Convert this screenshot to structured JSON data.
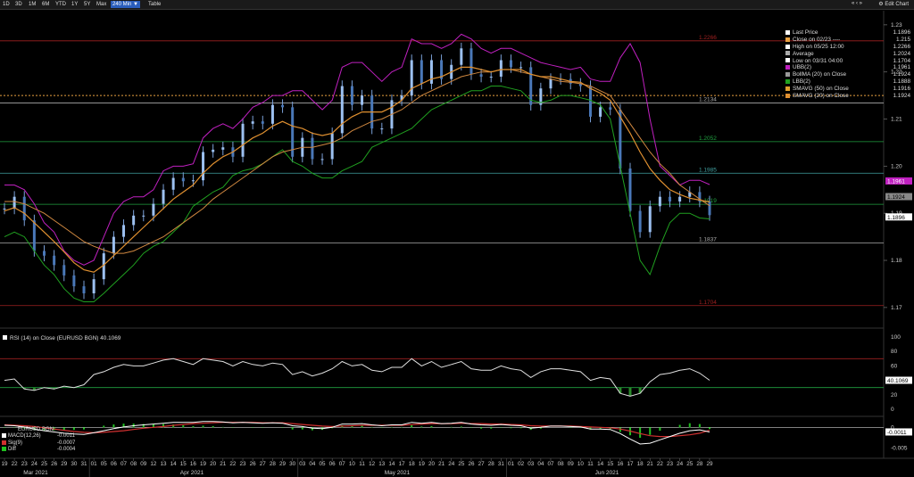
{
  "toolbar": {
    "ranges": [
      "1D",
      "3D",
      "1M",
      "6M",
      "YTD",
      "1Y",
      "5Y",
      "Max"
    ],
    "interval": "240 Min ▼",
    "table": "Table",
    "nav": "« ‹ »",
    "edit_chart": "Edit Chart",
    "edit_chart_icon": "gear-icon"
  },
  "legend": [
    {
      "label": "Last Price",
      "value": "1.1896",
      "color": "#ffffff"
    },
    {
      "label": "Close on 02/23 ----",
      "value": "1.215",
      "color": "#e8a040"
    },
    {
      "label": "High on 05/25 12:00",
      "value": "1.2266",
      "color": "#ffffff",
      "symbol": "T"
    },
    {
      "label": "Average",
      "value": "1.2024",
      "color": "#aaaaaa",
      "symbol": "+"
    },
    {
      "label": "Low on 03/31 04:00",
      "value": "1.1704",
      "color": "#ffffff",
      "symbol": "⊥"
    },
    {
      "label": "UBB(2)",
      "value": "1.1961",
      "color": "#c020c0"
    },
    {
      "label": "BollMA (20)  on Close",
      "value": "1.1924",
      "color": "#999999"
    },
    {
      "label": "LBB(2)",
      "value": "1.1888",
      "color": "#20a020"
    },
    {
      "label": "SMAVG (50)  on Close",
      "value": "1.1916",
      "color": "#e0a030"
    },
    {
      "label": "SMAVG (20)  on Close",
      "value": "1.1924",
      "color": "#e09030"
    }
  ],
  "price_axis_labels": [
    "1.23",
    "1.22",
    "1.21",
    "1.20",
    "1.19",
    "1.18",
    "1.17"
  ],
  "hline_labels": [
    "1.2266",
    "1.2134",
    "1.2052",
    "1.1985",
    "1.1919",
    "1.1837",
    "1.1704"
  ],
  "price_tags": [
    {
      "text": "1.1961",
      "color": "#c020c0",
      "textcolor": "#fff"
    },
    {
      "text": "1.1924",
      "color": "#888888",
      "textcolor": "#000"
    },
    {
      "text": "1.1896",
      "color": "#ffffff",
      "textcolor": "#000"
    }
  ],
  "rsi": {
    "title": "RSI (14)  on Close (EURUSD BGN) 40.1069",
    "axis_labels": [
      "100",
      "80",
      "60",
      "40",
      "20",
      "0"
    ],
    "tag": "40.1069"
  },
  "macd": {
    "title": "EURUSD BGN",
    "legend": [
      {
        "label": "MACD(12,26)",
        "value": "-0.0011",
        "color": "#ffffff"
      },
      {
        "label": "Sig(9)",
        "value": "-0.0007",
        "color": "#d03030"
      },
      {
        "label": "Diff",
        "value": "-0.0004",
        "color": "#20c020"
      }
    ],
    "axis_labels": [
      "0",
      "-0.005"
    ],
    "tag": "-0.0011"
  },
  "x_days": [
    "19",
    "22",
    "23",
    "24",
    "25",
    "26",
    "29",
    "30",
    "31",
    "01",
    "05",
    "06",
    "07",
    "08",
    "09",
    "12",
    "13",
    "14",
    "15",
    "16",
    "19",
    "20",
    "21",
    "22",
    "23",
    "26",
    "27",
    "28",
    "29",
    "30",
    "03",
    "04",
    "05",
    "06",
    "07",
    "10",
    "11",
    "12",
    "13",
    "14",
    "17",
    "18",
    "19",
    "20",
    "21",
    "24",
    "25",
    "26",
    "27",
    "28",
    "31",
    "01",
    "02",
    "03",
    "04",
    "07",
    "08",
    "09",
    "10",
    "11",
    "14",
    "15",
    "16",
    "17",
    "18",
    "21",
    "22",
    "23",
    "24",
    "25",
    "28",
    "29"
  ],
  "x_months": [
    "Mar 2021",
    "Apr 2021",
    "May 2021",
    "Jun 2021"
  ],
  "chart_data": {
    "type": "line",
    "title": "",
    "xlabel": "",
    "ylabel": "",
    "ylim": [
      1.166,
      1.233
    ],
    "x": [
      "Mar 19",
      "Mar 22",
      "Mar 23",
      "Mar 24",
      "Mar 25",
      "Mar 26",
      "Mar 29",
      "Mar 30",
      "Mar 31",
      "Apr 01",
      "Apr 05",
      "Apr 06",
      "Apr 07",
      "Apr 08",
      "Apr 09",
      "Apr 12",
      "Apr 13",
      "Apr 14",
      "Apr 15",
      "Apr 16",
      "Apr 19",
      "Apr 20",
      "Apr 21",
      "Apr 22",
      "Apr 23",
      "Apr 26",
      "Apr 27",
      "Apr 28",
      "Apr 29",
      "Apr 30",
      "May 03",
      "May 04",
      "May 05",
      "May 06",
      "May 07",
      "May 10",
      "May 11",
      "May 12",
      "May 13",
      "May 14",
      "May 17",
      "May 18",
      "May 19",
      "May 20",
      "May 21",
      "May 24",
      "May 25",
      "May 26",
      "May 27",
      "May 28",
      "May 31",
      "Jun 01",
      "Jun 02",
      "Jun 03",
      "Jun 04",
      "Jun 07",
      "Jun 08",
      "Jun 09",
      "Jun 10",
      "Jun 11",
      "Jun 14",
      "Jun 15",
      "Jun 16",
      "Jun 17",
      "Jun 18",
      "Jun 21",
      "Jun 22",
      "Jun 23",
      "Jun 24",
      "Jun 25",
      "Jun 28",
      "Jun 29"
    ],
    "series": [
      {
        "name": "Last Price",
        "color": "#8ab0e0",
        "values": [
          1.191,
          1.1935,
          1.1885,
          1.182,
          1.181,
          1.179,
          1.1768,
          1.1745,
          1.173,
          1.176,
          1.1815,
          1.185,
          1.1875,
          1.1895,
          1.1895,
          1.192,
          1.195,
          1.1975,
          1.1968,
          1.197,
          1.203,
          1.2035,
          1.204,
          1.202,
          1.209,
          1.2095,
          1.209,
          1.213,
          1.2125,
          1.202,
          1.206,
          1.2015,
          1.2015,
          1.207,
          1.217,
          1.213,
          1.215,
          1.208,
          1.208,
          1.214,
          1.215,
          1.2225,
          1.2175,
          1.2225,
          1.2185,
          1.2215,
          1.225,
          1.2195,
          1.219,
          1.219,
          1.2225,
          1.221,
          1.221,
          1.213,
          1.2165,
          1.2185,
          1.2185,
          1.2175,
          1.217,
          1.2105,
          1.2125,
          1.212,
          1.1995,
          1.1905,
          1.186,
          1.1915,
          1.1935,
          1.1925,
          1.1935,
          1.1945,
          1.1925,
          1.1896
        ]
      },
      {
        "name": "UBB(2)",
        "color": "#c020c0",
        "values": [
          1.196,
          1.196,
          1.195,
          1.192,
          1.188,
          1.186,
          1.182,
          1.18,
          1.179,
          1.18,
          1.185,
          1.19,
          1.1925,
          1.1935,
          1.1935,
          1.195,
          1.199,
          1.2,
          1.2,
          1.2005,
          1.206,
          1.208,
          1.209,
          1.208,
          1.21,
          1.2125,
          1.2135,
          1.215,
          1.215,
          1.216,
          1.216,
          1.214,
          1.212,
          1.214,
          1.221,
          1.222,
          1.222,
          1.22,
          1.218,
          1.22,
          1.221,
          1.227,
          1.226,
          1.226,
          1.225,
          1.226,
          1.228,
          1.227,
          1.225,
          1.224,
          1.225,
          1.225,
          1.224,
          1.223,
          1.222,
          1.2215,
          1.221,
          1.2205,
          1.221,
          1.2185,
          1.218,
          1.218,
          1.223,
          1.226,
          1.222,
          1.21,
          1.2,
          1.198,
          1.196,
          1.197,
          1.197,
          1.1961
        ]
      },
      {
        "name": "BollMA (20)  on Close",
        "color": "#999999",
        "values": [
          1.1905,
          1.1912,
          1.19,
          1.188,
          1.186,
          1.184,
          1.1818,
          1.1795,
          1.178,
          1.1775,
          1.179,
          1.181,
          1.183,
          1.185,
          1.187,
          1.189,
          1.191,
          1.193,
          1.1945,
          1.196,
          1.1985,
          1.2005,
          1.202,
          1.203,
          1.2045,
          1.206,
          1.207,
          1.2085,
          1.2095,
          1.2085,
          1.208,
          1.207,
          1.2065,
          1.207,
          1.209,
          1.2105,
          1.2115,
          1.2115,
          1.2115,
          1.2125,
          1.214,
          1.2165,
          1.2175,
          1.2185,
          1.219,
          1.22,
          1.221,
          1.221,
          1.2205,
          1.22,
          1.2205,
          1.2205,
          1.2205,
          1.2195,
          1.219,
          1.219,
          1.2185,
          1.218,
          1.2178,
          1.2165,
          1.2155,
          1.214,
          1.2105,
          1.207,
          1.203,
          1.1995,
          1.197,
          1.195,
          1.194,
          1.1932,
          1.1928,
          1.1924
        ]
      },
      {
        "name": "LBB(2)",
        "color": "#20a020",
        "values": [
          1.185,
          1.186,
          1.185,
          1.182,
          1.179,
          1.177,
          1.174,
          1.172,
          1.1712,
          1.1712,
          1.173,
          1.175,
          1.177,
          1.179,
          1.1815,
          1.183,
          1.184,
          1.186,
          1.188,
          1.1915,
          1.193,
          1.1945,
          1.1955,
          1.198,
          1.199,
          1.1995,
          1.2005,
          1.202,
          1.2035,
          1.201,
          1.2,
          1.1985,
          1.1975,
          1.1975,
          1.199,
          1.2,
          1.201,
          1.204,
          1.205,
          1.206,
          1.207,
          1.208,
          1.21,
          1.212,
          1.213,
          1.214,
          1.215,
          1.216,
          1.216,
          1.217,
          1.217,
          1.2165,
          1.216,
          1.214,
          1.2135,
          1.214,
          1.215,
          1.215,
          1.2145,
          1.214,
          1.213,
          1.21,
          1.2,
          1.19,
          1.18,
          1.177,
          1.183,
          1.188,
          1.19,
          1.19,
          1.189,
          1.1888
        ]
      },
      {
        "name": "SMAVG (50)  on Close",
        "color": "#d08840",
        "values": [
          1.1925,
          1.1925,
          1.192,
          1.191,
          1.19,
          1.1885,
          1.187,
          1.1855,
          1.184,
          1.183,
          1.1822,
          1.1815,
          1.1815,
          1.182,
          1.183,
          1.184,
          1.185,
          1.1865,
          1.188,
          1.1895,
          1.191,
          1.193,
          1.1945,
          1.196,
          1.1975,
          1.199,
          1.2005,
          1.202,
          1.203,
          1.2035,
          1.204,
          1.204,
          1.2045,
          1.205,
          1.206,
          1.2075,
          1.2085,
          1.2095,
          1.21,
          1.211,
          1.212,
          1.2135,
          1.215,
          1.216,
          1.217,
          1.218,
          1.219,
          1.2195,
          1.22,
          1.22,
          1.2205,
          1.2205,
          1.22,
          1.2195,
          1.219,
          1.2185,
          1.218,
          1.2178,
          1.2175,
          1.217,
          1.216,
          1.215,
          1.212,
          1.209,
          1.206,
          1.203,
          1.2005,
          1.1985,
          1.196,
          1.1945,
          1.193,
          1.1916
        ]
      },
      {
        "name": "SMAVG (20)  on Close",
        "color": "#e09030",
        "values": [
          1.1905,
          1.1912,
          1.19,
          1.188,
          1.186,
          1.184,
          1.1818,
          1.1795,
          1.178,
          1.1775,
          1.179,
          1.181,
          1.183,
          1.185,
          1.187,
          1.189,
          1.191,
          1.193,
          1.1945,
          1.196,
          1.1985,
          1.2005,
          1.202,
          1.203,
          1.2045,
          1.206,
          1.207,
          1.2085,
          1.2095,
          1.2085,
          1.208,
          1.207,
          1.2065,
          1.207,
          1.209,
          1.2105,
          1.2115,
          1.2115,
          1.2115,
          1.2125,
          1.214,
          1.2165,
          1.2175,
          1.2185,
          1.219,
          1.22,
          1.221,
          1.221,
          1.2205,
          1.22,
          1.2205,
          1.2205,
          1.2205,
          1.2195,
          1.219,
          1.219,
          1.2185,
          1.218,
          1.2178,
          1.2165,
          1.2155,
          1.214,
          1.2105,
          1.207,
          1.203,
          1.1995,
          1.197,
          1.195,
          1.194,
          1.1932,
          1.1928,
          1.1924
        ]
      }
    ],
    "hlines": [
      {
        "value": 1.2266,
        "color": "#a02020"
      },
      {
        "value": 1.2134,
        "color": "#aaaaaa"
      },
      {
        "value": 1.2052,
        "color": "#20a040"
      },
      {
        "value": 1.1985,
        "color": "#40a0a0"
      },
      {
        "value": 1.1919,
        "color": "#20a040"
      },
      {
        "value": 1.1837,
        "color": "#aaaaaa"
      },
      {
        "value": 1.1704,
        "color": "#a02020"
      },
      {
        "value": 1.215,
        "color": "#e8a040",
        "dashed": true
      }
    ],
    "rsi": {
      "ylim": [
        0,
        100
      ],
      "overbought": 70,
      "oversold": 30,
      "values": [
        40,
        42,
        28,
        26,
        30,
        28,
        32,
        30,
        34,
        48,
        52,
        58,
        62,
        60,
        60,
        64,
        68,
        70,
        66,
        62,
        70,
        68,
        66,
        60,
        66,
        62,
        60,
        64,
        62,
        48,
        52,
        46,
        50,
        56,
        66,
        60,
        62,
        54,
        52,
        58,
        58,
        70,
        60,
        66,
        58,
        62,
        66,
        56,
        54,
        54,
        60,
        56,
        54,
        44,
        52,
        56,
        56,
        54,
        52,
        40,
        44,
        42,
        22,
        18,
        22,
        38,
        48,
        50,
        54,
        56,
        50,
        40.1
      ]
    },
    "macd": {
      "ylim": [
        -0.007,
        0.002
      ],
      "macd": [
        0.0005,
        0.0004,
        0.0001,
        -0.0004,
        -0.0008,
        -0.0011,
        -0.0014,
        -0.0016,
        -0.0017,
        -0.0013,
        -0.0008,
        -0.0003,
        0.0001,
        0.0004,
        0.0006,
        0.0008,
        0.001,
        0.0012,
        0.0012,
        0.0012,
        0.0014,
        0.0014,
        0.0013,
        0.0011,
        0.0012,
        0.0011,
        0.001,
        0.0011,
        0.001,
        0.0004,
        0.0002,
        -0.0002,
        -0.0003,
        0.0,
        0.0008,
        0.0008,
        0.0009,
        0.0006,
        0.0004,
        0.0006,
        0.0006,
        0.0012,
        0.001,
        0.0012,
        0.0009,
        0.001,
        0.0012,
        0.0008,
        0.0006,
        0.0005,
        0.0007,
        0.0005,
        0.0004,
        -0.0002,
        0.0,
        0.0003,
        0.0003,
        0.0002,
        0.0001,
        -0.0004,
        -0.0004,
        -0.0005,
        -0.0015,
        -0.0028,
        -0.004,
        -0.0038,
        -0.003,
        -0.0022,
        -0.0014,
        -0.0008,
        -0.0006,
        -0.0011
      ],
      "signal": [
        0.0006,
        0.0005,
        0.0004,
        0.0002,
        -0.0001,
        -0.0004,
        -0.0007,
        -0.001,
        -0.0012,
        -0.0013,
        -0.0012,
        -0.001,
        -0.0008,
        -0.0005,
        -0.0002,
        0.0,
        0.0002,
        0.0005,
        0.0007,
        0.0009,
        0.001,
        0.0011,
        0.0012,
        0.0012,
        0.0012,
        0.0012,
        0.0011,
        0.0011,
        0.0011,
        0.0009,
        0.0007,
        0.0005,
        0.0003,
        0.0002,
        0.0003,
        0.0004,
        0.0005,
        0.0005,
        0.0005,
        0.0005,
        0.0005,
        0.0007,
        0.0008,
        0.0009,
        0.0009,
        0.0009,
        0.001,
        0.0009,
        0.0009,
        0.0008,
        0.0008,
        0.0007,
        0.0006,
        0.0004,
        0.0003,
        0.0003,
        0.0003,
        0.0003,
        0.0002,
        0.0001,
        0.0,
        -0.0001,
        -0.0004,
        -0.0009,
        -0.0015,
        -0.002,
        -0.0022,
        -0.0022,
        -0.002,
        -0.0018,
        -0.0014,
        -0.0007
      ]
    }
  }
}
